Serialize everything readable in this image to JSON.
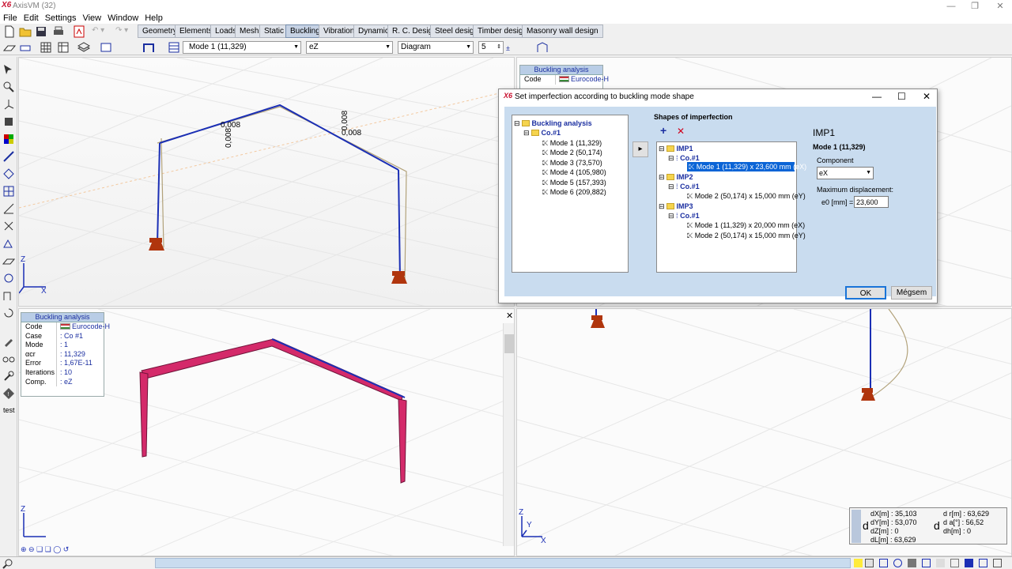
{
  "app": {
    "title": "AxisVM (32)",
    "logo": "X6"
  },
  "menu": [
    "File",
    "Edit",
    "Settings",
    "View",
    "Window",
    "Help"
  ],
  "tabs": [
    "Geometry",
    "Elements",
    "Loads",
    "Mesh",
    "Static",
    "Buckling",
    "Vibration",
    "Dynamic",
    "R. C. Design",
    "Steel design",
    "Timber design",
    "Masonry wall design"
  ],
  "active_tab": "Buckling",
  "toolbar2": {
    "mode_combo": "Mode 1 (11,329)",
    "component_combo": "eZ",
    "display_combo": "Diagram",
    "scale_value": "5"
  },
  "left_toolbar": {
    "test_label": "test"
  },
  "viewport_tl": {
    "labels": [
      "0,008",
      "0,008",
      "0,008",
      "0,008"
    ],
    "axes": {
      "z": "Z",
      "x": "X"
    }
  },
  "info_table": {
    "header": "Buckling analysis",
    "rows": [
      {
        "k": "Code",
        "v": "Eurocode-H",
        "flag": true
      },
      {
        "k": "Case",
        "v": ": Co #1"
      },
      {
        "k": "Mode",
        "v": ": 1"
      },
      {
        "k": "αcr",
        "v": ": 11,329"
      },
      {
        "k": "Error",
        "v": ": 1,67E-11"
      },
      {
        "k": "Iterations",
        "v": ": 10"
      },
      {
        "k": "Comp.",
        "v": ": eZ"
      }
    ]
  },
  "info_table_tr": {
    "header": "Buckling analysis",
    "code_label": "Code",
    "code_value": "Eurocode-H"
  },
  "viewport_bl": {
    "axes": {
      "z": "Z",
      "y": "Y",
      "x": "X"
    }
  },
  "viewport_br": {
    "axes": {
      "z": "Z",
      "y": "Y",
      "x": "X"
    }
  },
  "dialog": {
    "title": "Set imperfection according to buckling mode shape",
    "left_tree": {
      "root": "Buckling analysis",
      "case": "Co.#1",
      "modes": [
        "Mode 1 (11,329)",
        "Mode 2 (50,174)",
        "Mode 3 (73,570)",
        "Mode 4 (105,980)",
        "Mode 5 (157,393)",
        "Mode 6 (209,882)"
      ]
    },
    "shapes_label": "Shapes of imperfection",
    "right_tree": [
      {
        "imp": "IMP1",
        "case": "Co.#1",
        "modes": [
          "Mode 1 (11,329) x 23,600 mm (eX)"
        ]
      },
      {
        "imp": "IMP2",
        "case": "Co.#1",
        "modes": [
          "Mode 2 (50,174) x 15,000 mm (eY)"
        ]
      },
      {
        "imp": "IMP3",
        "case": "Co.#1",
        "modes": [
          "Mode 1 (11,329) x 20,000 mm (eX)",
          "Mode 2 (50,174) x 15,000 mm (eY)"
        ]
      }
    ],
    "selected_mode": "Mode 1 (11,329) x 23,600 mm (eX)",
    "detail": {
      "imp": "IMP1",
      "mode": "Mode 1 (11,329)",
      "component_label": "Component",
      "component_value": "eX",
      "max_disp_label": "Maximum displacement:",
      "e0_label": "e0 [mm] =",
      "e0_value": "23,600"
    },
    "ok": "OK",
    "cancel": "Mégsem"
  },
  "measure": {
    "left": [
      {
        "k": "dX[m]",
        "v": ": 35,103"
      },
      {
        "k": "dY[m]",
        "v": ": 53,070"
      },
      {
        "k": "dZ[m]",
        "v": ": 0"
      },
      {
        "k": "dL[m]",
        "v": ": 63,629"
      }
    ],
    "right": [
      {
        "k": "d r[m]",
        "v": ": 63,629"
      },
      {
        "k": "d  a[°]",
        "v": ": 56,52"
      },
      {
        "k": "dh[m]",
        "v": ": 0"
      }
    ]
  },
  "colors": {
    "accent": "#1a2ea0",
    "beam": "#d42a6a",
    "frame": "#1b2fb5",
    "imperfection": "#b2a27a"
  }
}
